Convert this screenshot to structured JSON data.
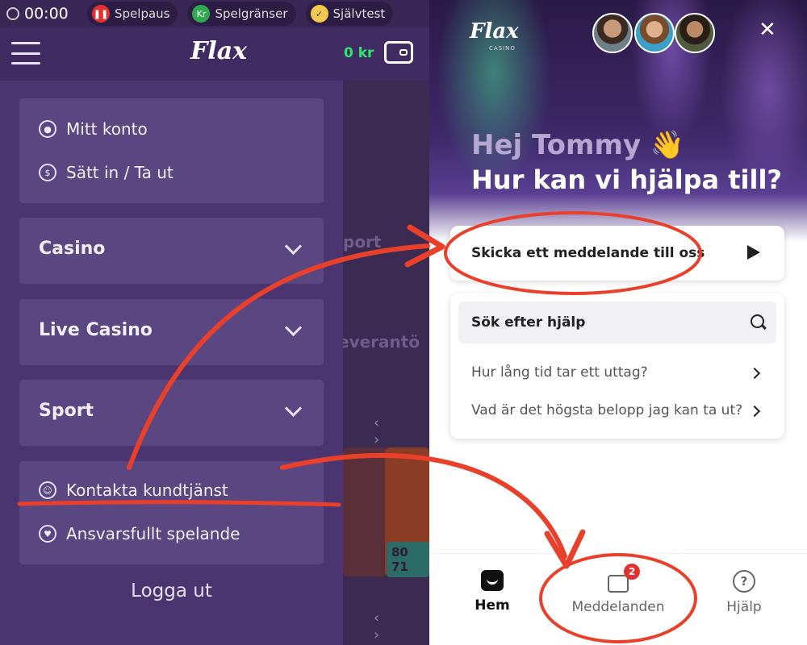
{
  "statusbar": {
    "time": "00:00",
    "pills": [
      {
        "label": "Spelpaus",
        "icon": "pause-icon",
        "color": "#e03131"
      },
      {
        "label": "Spelgränser",
        "icon": "limit-icon",
        "color": "#2fa84f"
      },
      {
        "label": "Självtest",
        "icon": "selftest-icon",
        "color": "#f2c94c"
      }
    ]
  },
  "header": {
    "logo": "Flax",
    "balance": "0 kr"
  },
  "menu": {
    "account": [
      {
        "label": "Mitt konto",
        "icon": "user-icon"
      },
      {
        "label": "Sätt in / Ta ut",
        "icon": "money-icon"
      }
    ],
    "sections": [
      "Casino",
      "Live Casino",
      "Sport"
    ],
    "support": [
      {
        "label": "Kontakta kundtjänst",
        "icon": "support-icon"
      },
      {
        "label": "Ansvarsfullt spelande",
        "icon": "responsible-icon"
      }
    ],
    "logout": "Logga ut"
  },
  "background": {
    "sport": "port",
    "provider": "everantö",
    "amount": "80 71"
  },
  "chat": {
    "logo": "Flax",
    "logo_sub": "CASINO",
    "greeting": "Hej Tommy",
    "greeting_emoji": "👋",
    "question": "Hur kan vi hjälpa till?",
    "send_label": "Skicka ett meddelande till oss",
    "search_label": "Sök efter hjälp",
    "faqs": [
      "Hur lång tid tar ett uttag?",
      "Vad är det högsta belopp jag kan ta ut?"
    ],
    "tabs": {
      "home": "Hem",
      "messages": "Meddelanden",
      "messages_badge": "2",
      "help": "Hjälp"
    }
  },
  "colors": {
    "menu_bg": "#4b3570",
    "accent_green": "#2ee86b",
    "annotation_red": "#e8402a",
    "badge_red": "#e03131"
  }
}
